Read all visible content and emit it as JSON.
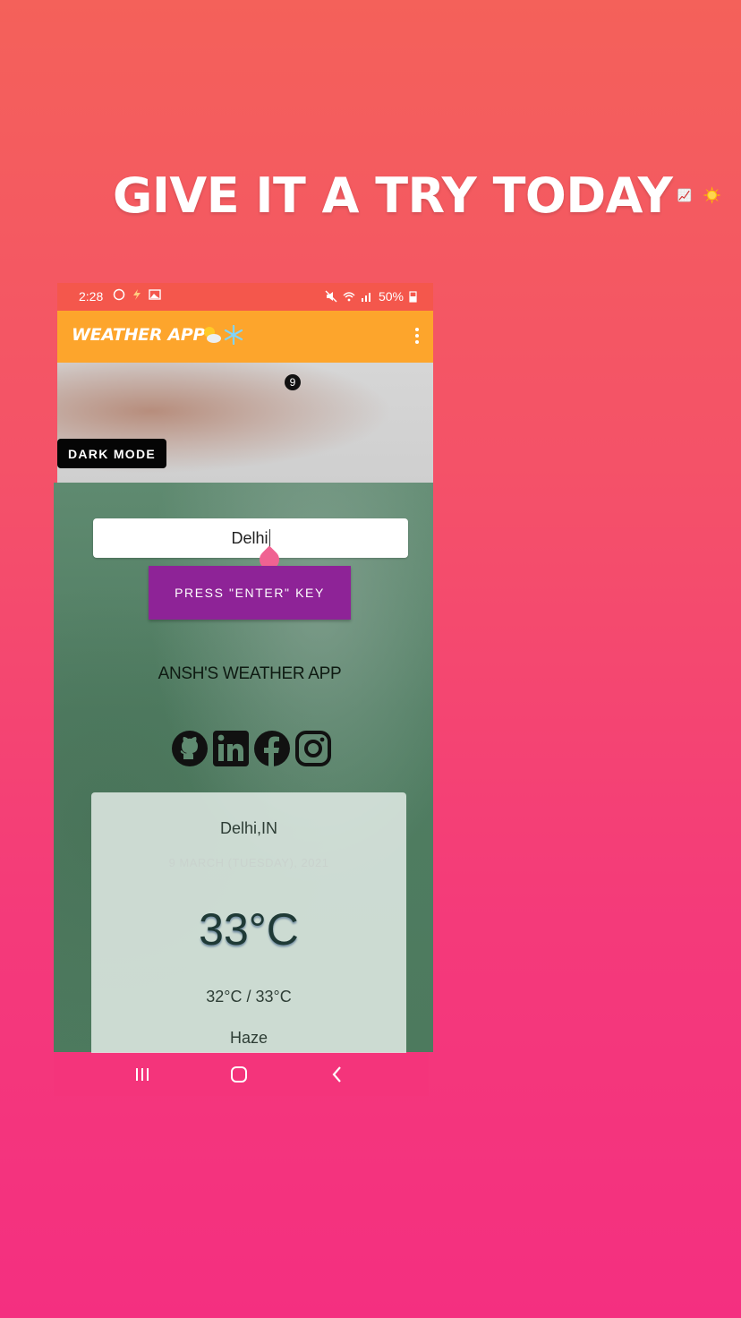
{
  "headline": {
    "text": "GIVE IT A TRY TODAY"
  },
  "status_bar": {
    "time": "2:28",
    "battery": "50%"
  },
  "app_bar": {
    "title": "WEATHER APP"
  },
  "badge": "9",
  "dark_mode_label": "DARK MODE",
  "search": {
    "value": "Delhi"
  },
  "press_button_label": "PRESS \"ENTER\" KEY",
  "app_name": "ANSH'S WEATHER APP",
  "social_icons": [
    "github-icon",
    "linkedin-icon",
    "facebook-icon",
    "instagram-icon"
  ],
  "weather": {
    "city": "Delhi,IN",
    "date": "9 MARCH (TUESDAY), 2021",
    "temperature": "33°C",
    "range": "32°C / 33°C",
    "condition": "Haze"
  },
  "colors": {
    "status_bar": "#f4574c",
    "app_bar": "#fda52c",
    "button": "#8e2397",
    "nav_bar": "#f4347b"
  }
}
